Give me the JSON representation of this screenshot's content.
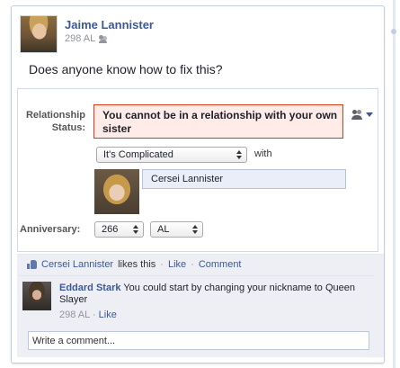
{
  "post": {
    "author": "Jaime Lannister",
    "age": "298 AL",
    "text": "Does anyone know how to fix this?"
  },
  "relationship": {
    "label": "Relationship Status:",
    "error": "You cannot be in a relationship with your own sister",
    "status_selected": "It's Complicated",
    "with_label": "with",
    "partner": "Cersei Lannister",
    "anniversary_label": "Anniversary:",
    "year_selected": "266",
    "era_selected": "AL",
    "privacy_icon": "friends-icon"
  },
  "actions": {
    "liker": "Cersei Lannister",
    "likes_text": "likes this",
    "dot": "·",
    "like": "Like",
    "comment": "Comment"
  },
  "comments": [
    {
      "author": "Eddard Stark",
      "text": "You could start by changing your nickname to Queen Slayer",
      "age": "298 AL",
      "like": "Like"
    }
  ],
  "composer": {
    "placeholder": "Write a comment..."
  },
  "colors": {
    "link": "#3b5998",
    "error_bg": "#ffebe8",
    "error_border": "#dd3c10",
    "ufi_bg": "#edeff4"
  }
}
